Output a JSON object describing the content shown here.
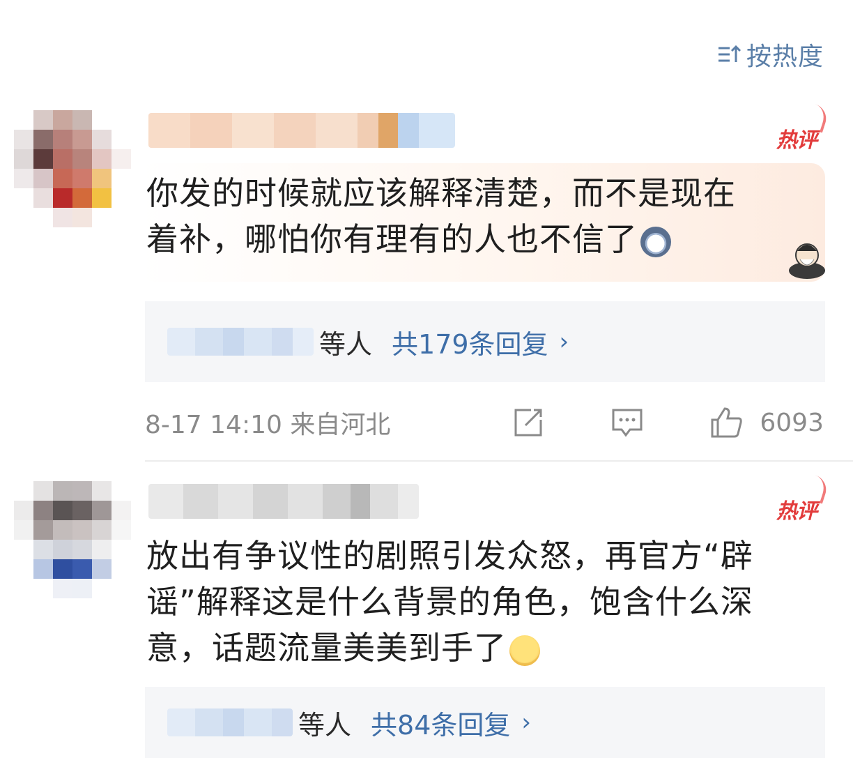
{
  "sort": {
    "label": "按热度",
    "icon": "sort-icon"
  },
  "comments": [
    {
      "badge": "热评",
      "text_lines": [
        "你发的时候就应该解释清楚，而不是现在",
        "着补，哪怕你有理有的人也不信了"
      ],
      "emoji": "scared-face-emoji",
      "replies": {
        "who": "等人",
        "count_label": "共179条回复"
      },
      "meta": {
        "time_location": "8-17 14:10 来自河北",
        "likes": "6093"
      }
    },
    {
      "badge": "热评",
      "text_lines": [
        "放出有争议性的剧照引发众怒，再官方“辟",
        "谣”解释这是什么背景的角色，饱含什么深",
        "意，话题流量美美到手了"
      ],
      "emoji": "smile-emoji",
      "replies": {
        "who": "等人",
        "count_label": "共84条回复"
      }
    }
  ],
  "colors": {
    "link": "#3e6ea8",
    "hot": "#e23b3b",
    "meta": "#8a8a8a"
  }
}
